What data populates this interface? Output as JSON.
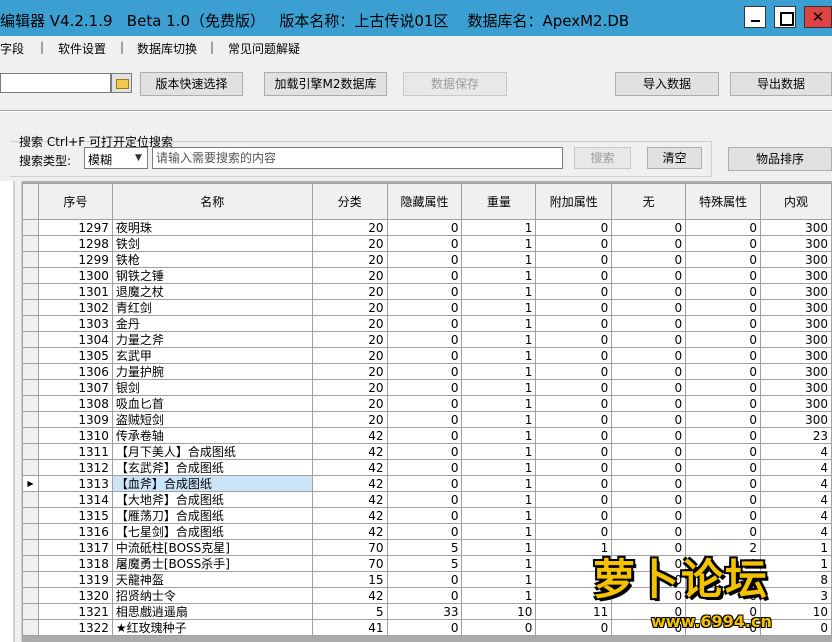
{
  "window": {
    "title": "编辑器 V4.2.1.9   Beta 1.0（免费版）   版本名称：上古传说01区    数据库名：ApexM2.DB",
    "close_glyph": "✕"
  },
  "menu": {
    "items": [
      "字段",
      "软件设置",
      "数据库切换",
      "常见问题解疑"
    ],
    "separator": "|"
  },
  "toolbar": {
    "version_select": "版本快速选择",
    "load_db": "加载引擎M2数据库",
    "save_data": "数据保存",
    "import_data": "导入数据",
    "export_data": "导出数据"
  },
  "search": {
    "tip": "搜索   Ctrl+F 可打开定位搜索",
    "type_label": "搜索类型:",
    "type_value": "模糊",
    "placeholder": "请输入需要搜索的内容",
    "search_button": "搜索",
    "clear_button": "清空",
    "sort_button": "物品排序"
  },
  "grid": {
    "columns": [
      "序号",
      "名称",
      "分类",
      "隐藏属性",
      "重量",
      "附加属性",
      "无",
      "特殊属性",
      "内观"
    ],
    "selected_row": 16,
    "rows": [
      [
        "1297",
        "夜明珠",
        "20",
        "0",
        "1",
        "0",
        "0",
        "0",
        "300"
      ],
      [
        "1298",
        "铁剑",
        "20",
        "0",
        "1",
        "0",
        "0",
        "0",
        "300"
      ],
      [
        "1299",
        "铁枪",
        "20",
        "0",
        "1",
        "0",
        "0",
        "0",
        "300"
      ],
      [
        "1300",
        "钢铁之锤",
        "20",
        "0",
        "1",
        "0",
        "0",
        "0",
        "300"
      ],
      [
        "1301",
        "退魔之杖",
        "20",
        "0",
        "1",
        "0",
        "0",
        "0",
        "300"
      ],
      [
        "1302",
        "青红剑",
        "20",
        "0",
        "1",
        "0",
        "0",
        "0",
        "300"
      ],
      [
        "1303",
        "金丹",
        "20",
        "0",
        "1",
        "0",
        "0",
        "0",
        "300"
      ],
      [
        "1304",
        "力量之斧",
        "20",
        "0",
        "1",
        "0",
        "0",
        "0",
        "300"
      ],
      [
        "1305",
        "玄武甲",
        "20",
        "0",
        "1",
        "0",
        "0",
        "0",
        "300"
      ],
      [
        "1306",
        "力量护腕",
        "20",
        "0",
        "1",
        "0",
        "0",
        "0",
        "300"
      ],
      [
        "1307",
        "银剑",
        "20",
        "0",
        "1",
        "0",
        "0",
        "0",
        "300"
      ],
      [
        "1308",
        "吸血匕首",
        "20",
        "0",
        "1",
        "0",
        "0",
        "0",
        "300"
      ],
      [
        "1309",
        "盗贼短剑",
        "20",
        "0",
        "1",
        "0",
        "0",
        "0",
        "300"
      ],
      [
        "1310",
        "传承卷轴",
        "42",
        "0",
        "1",
        "0",
        "0",
        "0",
        "23"
      ],
      [
        "1311",
        "【月下美人】合成图纸",
        "42",
        "0",
        "1",
        "0",
        "0",
        "0",
        "4"
      ],
      [
        "1312",
        "【玄武斧】合成图纸",
        "42",
        "0",
        "1",
        "0",
        "0",
        "0",
        "4"
      ],
      [
        "1313",
        "【血斧】合成图纸",
        "42",
        "0",
        "1",
        "0",
        "0",
        "0",
        "4"
      ],
      [
        "1314",
        "【大地斧】合成图纸",
        "42",
        "0",
        "1",
        "0",
        "0",
        "0",
        "4"
      ],
      [
        "1315",
        "【雁荡刀】合成图纸",
        "42",
        "0",
        "1",
        "0",
        "0",
        "0",
        "4"
      ],
      [
        "1316",
        "【七星剑】合成图纸",
        "42",
        "0",
        "1",
        "0",
        "0",
        "0",
        "4"
      ],
      [
        "1317",
        "中流砥柱[BOSS克星]",
        "70",
        "5",
        "1",
        "1",
        "0",
        "2",
        "1"
      ],
      [
        "1318",
        "屠魔勇士[BOSS杀手]",
        "70",
        "5",
        "1",
        "0",
        "0",
        "0",
        "1"
      ],
      [
        "1319",
        "天龍神盔",
        "15",
        "0",
        "1",
        "0",
        "0",
        "0",
        "8"
      ],
      [
        "1320",
        "招贤纳士令",
        "42",
        "0",
        "1",
        "0",
        "0",
        "0",
        "3"
      ],
      [
        "1321",
        "相思戲逍遥扇",
        "5",
        "33",
        "10",
        "11",
        "0",
        "0",
        "10"
      ],
      [
        "1322",
        "★红玫瑰种子",
        "41",
        "0",
        "0",
        "0",
        "0",
        "0",
        "0"
      ]
    ]
  },
  "watermark": {
    "logo_text": "萝卜论坛",
    "url": "www.6994.cn"
  }
}
